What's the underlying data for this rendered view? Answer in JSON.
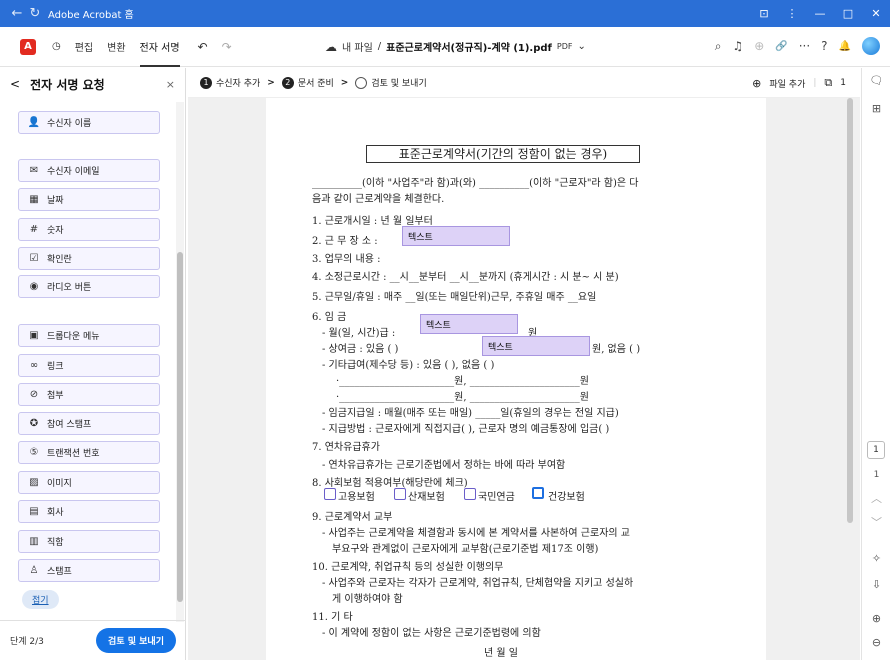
{
  "titlebar": {
    "app_name": "Adobe Acrobat 홈",
    "back": "←",
    "refresh": "↻",
    "icon1": "⊡",
    "menu": "⋮",
    "min": "—",
    "max": "□",
    "close": "✕"
  },
  "toolbar": {
    "logo": "A",
    "history": "◷",
    "edit": "편집",
    "convert": "변환",
    "esign": "전자 서명",
    "undo": "↶",
    "redo": "↷",
    "cloud": "☁",
    "breadcrumb_prefix": "내 파일",
    "separator": "/",
    "file_name": "표준근로계약서(정규직)-계약 (1).pdf",
    "file_type": "PDF",
    "dropdown": "⌄",
    "search": "⌕",
    "audio": "♫",
    "zoom": "⊕",
    "link": "🔗",
    "more": "···",
    "help": "?",
    "bell": "🔔"
  },
  "sidepanel": {
    "back": "<",
    "title": "전자 서명 요청",
    "close": "×",
    "fields": [
      {
        "label": "수신자 이름",
        "icon": "👤"
      },
      {
        "label": "수신자 이메일",
        "icon": "✉"
      },
      {
        "label": "날짜",
        "icon": "▦"
      },
      {
        "label": "숫자",
        "icon": "#"
      },
      {
        "label": "확인란",
        "icon": "☑"
      },
      {
        "label": "라디오 버튼",
        "icon": "◉"
      },
      {
        "label": "드롭다운 메뉴",
        "icon": "▣"
      },
      {
        "label": "링크",
        "icon": "∞"
      },
      {
        "label": "첨부",
        "icon": "⊘"
      },
      {
        "label": "참여 스탬프",
        "icon": "✪"
      },
      {
        "label": "트랜잭션 번호",
        "icon": "⑤"
      },
      {
        "label": "이미지",
        "icon": "▨"
      },
      {
        "label": "회사",
        "icon": "▤"
      },
      {
        "label": "직함",
        "icon": "▥"
      },
      {
        "label": "스탬프",
        "icon": "♙"
      }
    ],
    "collapse": "접기",
    "step": "단계 2/3",
    "send": "검토 및 보내기"
  },
  "stepbar": {
    "step1_num": "1",
    "step1": "수신자 추가",
    "step2_num": "2",
    "step2": "문서 준비",
    "step3": "검토 및 보내기",
    "chevron": ">",
    "add_file": "파일 추가",
    "add_file_icon": "⊕",
    "page_count": "1",
    "page_icon": "⧉"
  },
  "document": {
    "title": "표준근로계약서(기간의 정함이 없는 경우)",
    "intro1": "__________(이하 \"사업주\"라 함)과(와) __________(이하 \"근로자\"라 함)은 다",
    "intro2": "음과 같이 근로계약을 체결한다.",
    "l1": "1. 근로개시일 :        년    월    일부터",
    "l2": "2. 근 무 장 소 :",
    "l3": "3. 업무의 내용 :",
    "l4": "4. 소정근로시간 : __시__분부터 __시__분까지 (휴게시간 : 시 분~ 시  분)",
    "l5": "5. 근무일/휴일 : 매주 __일(또는 매일단위)근무, 주휴일 매주 __요일",
    "l6": "6. 임  금",
    "l6a": "- 월(일, 시간)급 :",
    "l6a_end": "원",
    "l6b": "- 상여금 : 있음 (     )",
    "l6b_end": "원,  없음 (      )",
    "l6c": "- 기타급여(제수당 등) : 있음 (      ),    없음 (     )",
    "l6d": "·_______________________원,  ______________________원",
    "l6e": "·_______________________원,  ______________________원",
    "l6f": "- 임금지급일 : 매월(매주 또는 매일) _____일(휴일의 경우는 전일 지급)",
    "l6g": "- 지급방법 : 근로자에게 직접지급(    ), 근로자 명의 예금통장에 입금(    )",
    "l7": "7. 연차유급휴가",
    "l7a": "- 연차유급휴가는 근로기준법에서 정하는 바에 따라 부여함",
    "l8": "8. 사회보험 적용여부(해당란에 체크)",
    "ins1": "고용보험",
    "ins2": "산재보험",
    "ins3": "국민연금",
    "ins4": "건강보험",
    "l9": "9. 근로계약서 교부",
    "l9a": "- 사업주는 근로계약을 체결함과 동시에 본 계약서를 사본하여 근로자의 교",
    "l9b": "부요구와 관계없이 근로자에게 교부함(근로기준법 제17조 이행)",
    "l10": "10. 근로계약, 취업규칙 등의 성실한 이행의무",
    "l10a": "- 사업주와 근로자는 각자가 근로계약, 취업규칙, 단체협약을 지키고 성실하",
    "l10b": "게 이행하여야 함",
    "l11": "11. 기  타",
    "l11a": "- 이 계약에 정함이 없는 사항은 근로기준법령에 의함",
    "date_line": "년        월        일",
    "text_field_label": "텍스트"
  },
  "rightbar": {
    "comment": "🗨",
    "grid": "⊞",
    "page_num": "1",
    "page_total": "1",
    "up": "︿",
    "down": "﹀",
    "ai": "✧",
    "export": "⇩",
    "zoom_in": "⊕",
    "zoom_out": "⊖"
  }
}
